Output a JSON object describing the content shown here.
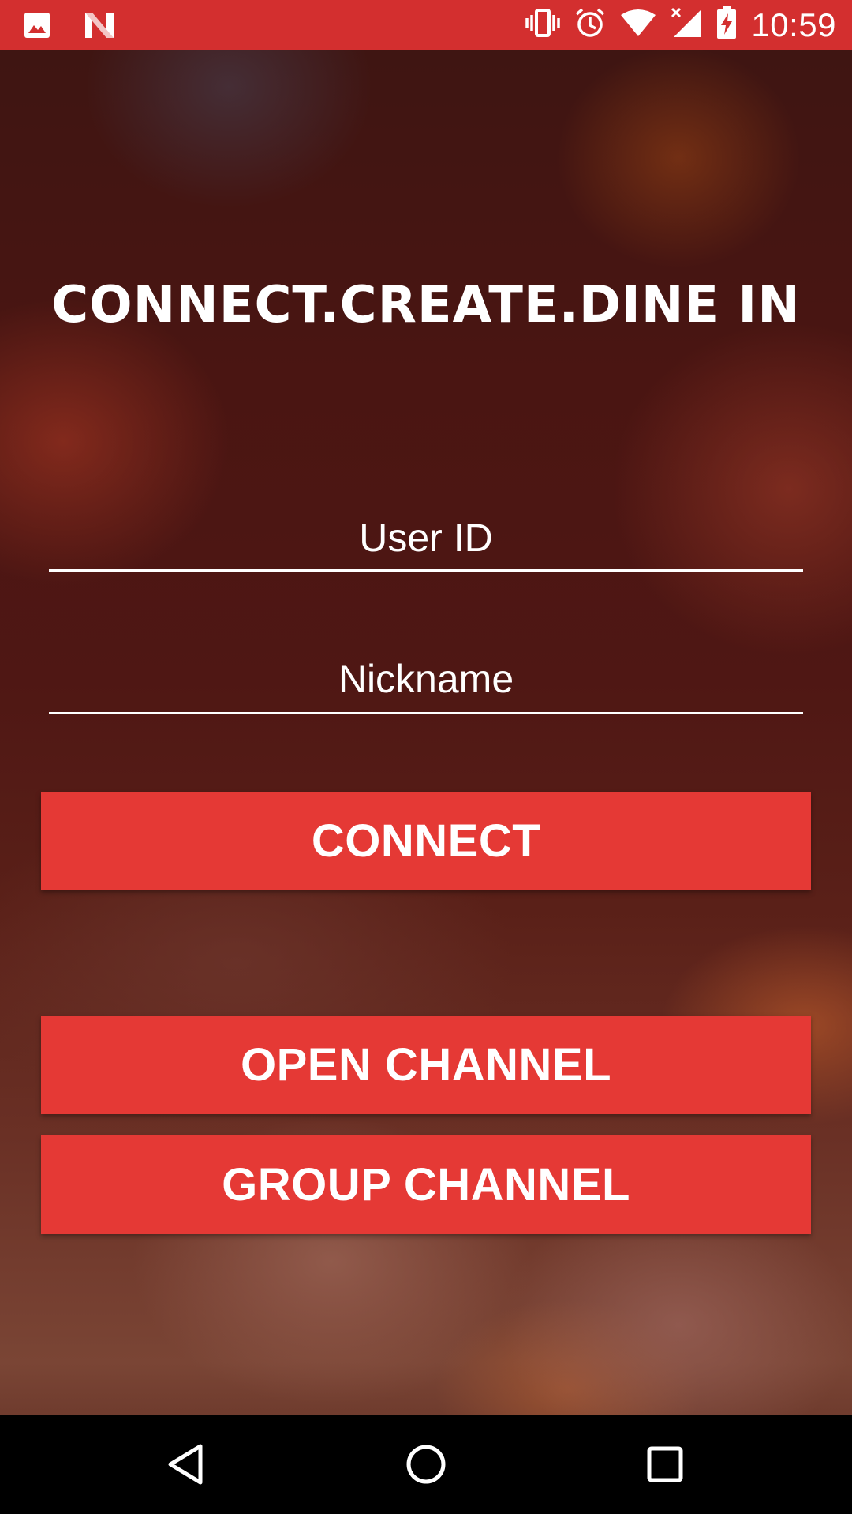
{
  "status_bar": {
    "time": "10:59",
    "left_icons": [
      "image-icon",
      "n-app-icon"
    ],
    "right_icons": [
      "vibrate-icon",
      "alarm-icon",
      "wifi-icon",
      "cell-signal-icon",
      "battery-charging-icon"
    ],
    "background_color": "#d32f2f"
  },
  "main": {
    "title": "CONNECT.CREATE.DINE IN",
    "user_id": {
      "value": "",
      "placeholder": "User ID"
    },
    "nickname": {
      "value": "",
      "placeholder": "Nickname"
    },
    "buttons": {
      "connect": "CONNECT",
      "open_channel": "OPEN CHANNEL",
      "group_channel": "GROUP CHANNEL"
    },
    "button_color": "#e53935"
  },
  "nav_bar": {
    "back_icon": "back-triangle-icon",
    "home_icon": "home-circle-icon",
    "recent_icon": "recent-square-icon"
  }
}
